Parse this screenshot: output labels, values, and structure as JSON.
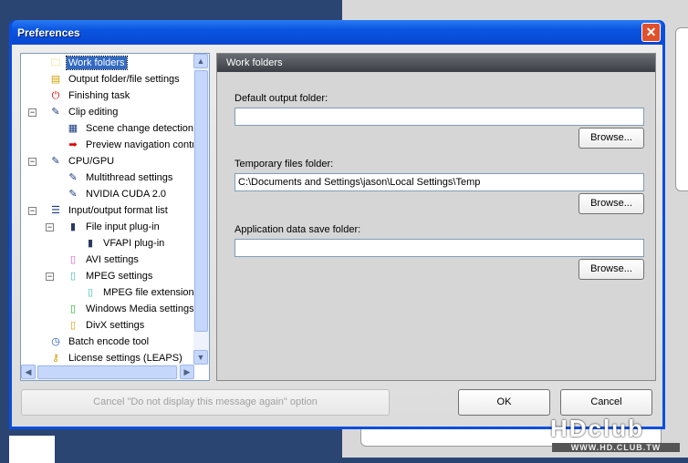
{
  "dialog": {
    "title": "Preferences",
    "close": "✕"
  },
  "tree": [
    {
      "label": "Work folders",
      "icon": "folder-icon",
      "glyph": "🗀",
      "color": "#e8c000",
      "level": 0,
      "selected": true
    },
    {
      "label": "Output folder/file settings",
      "icon": "folder-file-icon",
      "glyph": "▤",
      "color": "#d0a000",
      "level": 0
    },
    {
      "label": "Finishing task",
      "icon": "power-icon",
      "glyph": "⏻",
      "color": "#d00000",
      "level": 0
    },
    {
      "label": "Clip editing",
      "icon": "edit-document-icon",
      "glyph": "✎",
      "color": "#1a3a80",
      "level": 0,
      "expand": true
    },
    {
      "label": "Scene change detection",
      "icon": "film-icon",
      "glyph": "▦",
      "color": "#1a3a80",
      "level": 1
    },
    {
      "label": "Preview navigation control",
      "icon": "red-arrow-icon",
      "glyph": "➡",
      "color": "#e00000",
      "level": 1
    },
    {
      "label": "CPU/GPU",
      "icon": "edit-document-icon",
      "glyph": "✎",
      "color": "#1a3a80",
      "level": 0,
      "expand": true
    },
    {
      "label": "Multithread settings",
      "icon": "edit-document-icon",
      "glyph": "✎",
      "color": "#1a3a80",
      "level": 1
    },
    {
      "label": "NVIDIA CUDA 2.0",
      "icon": "edit-document-icon",
      "glyph": "✎",
      "color": "#1a3a80",
      "level": 1
    },
    {
      "label": "Input/output format list",
      "icon": "list-document-icon",
      "glyph": "☰",
      "color": "#1a3a80",
      "level": 0,
      "expand": true
    },
    {
      "label": "File input plug-in",
      "icon": "plugin-icon",
      "glyph": "▮",
      "color": "#2a3a60",
      "level": 1,
      "expand": true
    },
    {
      "label": "VFAPI plug-in",
      "icon": "plugin-icon",
      "glyph": "▮",
      "color": "#2a3a60",
      "level": 2
    },
    {
      "label": "AVI settings",
      "icon": "avi-file-icon",
      "glyph": "▯",
      "color": "#e060d0",
      "level": 1
    },
    {
      "label": "MPEG settings",
      "icon": "mpeg-file-icon",
      "glyph": "▯",
      "color": "#40c0b0",
      "level": 1,
      "expand": true
    },
    {
      "label": "MPEG file extension settings",
      "icon": "mpeg-file-icon",
      "glyph": "▯",
      "color": "#40c0b0",
      "level": 2
    },
    {
      "label": "Windows Media settings",
      "icon": "wmv-file-icon",
      "glyph": "▯",
      "color": "#20b020",
      "level": 1
    },
    {
      "label": "DivX settings",
      "icon": "divx-file-icon",
      "glyph": "▯",
      "color": "#e0a000",
      "level": 1
    },
    {
      "label": "Batch encode tool",
      "icon": "clock-icon",
      "glyph": "◷",
      "color": "#1a50b0",
      "level": 0
    },
    {
      "label": "License settings (LEAPS)",
      "icon": "key-icon",
      "glyph": "⚷",
      "color": "#d0a000",
      "level": 0
    }
  ],
  "panel": {
    "header": "Work folders",
    "fields": [
      {
        "label": "Default output folder:",
        "value": "",
        "browse": "Browse..."
      },
      {
        "label": "Temporary files folder:",
        "value": "C:\\Documents and Settings\\jason\\Local Settings\\Temp",
        "browse": "Browse..."
      },
      {
        "label": "Application data save folder:",
        "value": "",
        "browse": "Browse..."
      }
    ]
  },
  "buttons": {
    "cancel_option": "Cancel \"Do not display this message again\" option",
    "ok": "OK",
    "cancel": "Cancel"
  },
  "watermark": {
    "logo": "HDclub",
    "url": "WWW.HD.CLUB.TW"
  }
}
